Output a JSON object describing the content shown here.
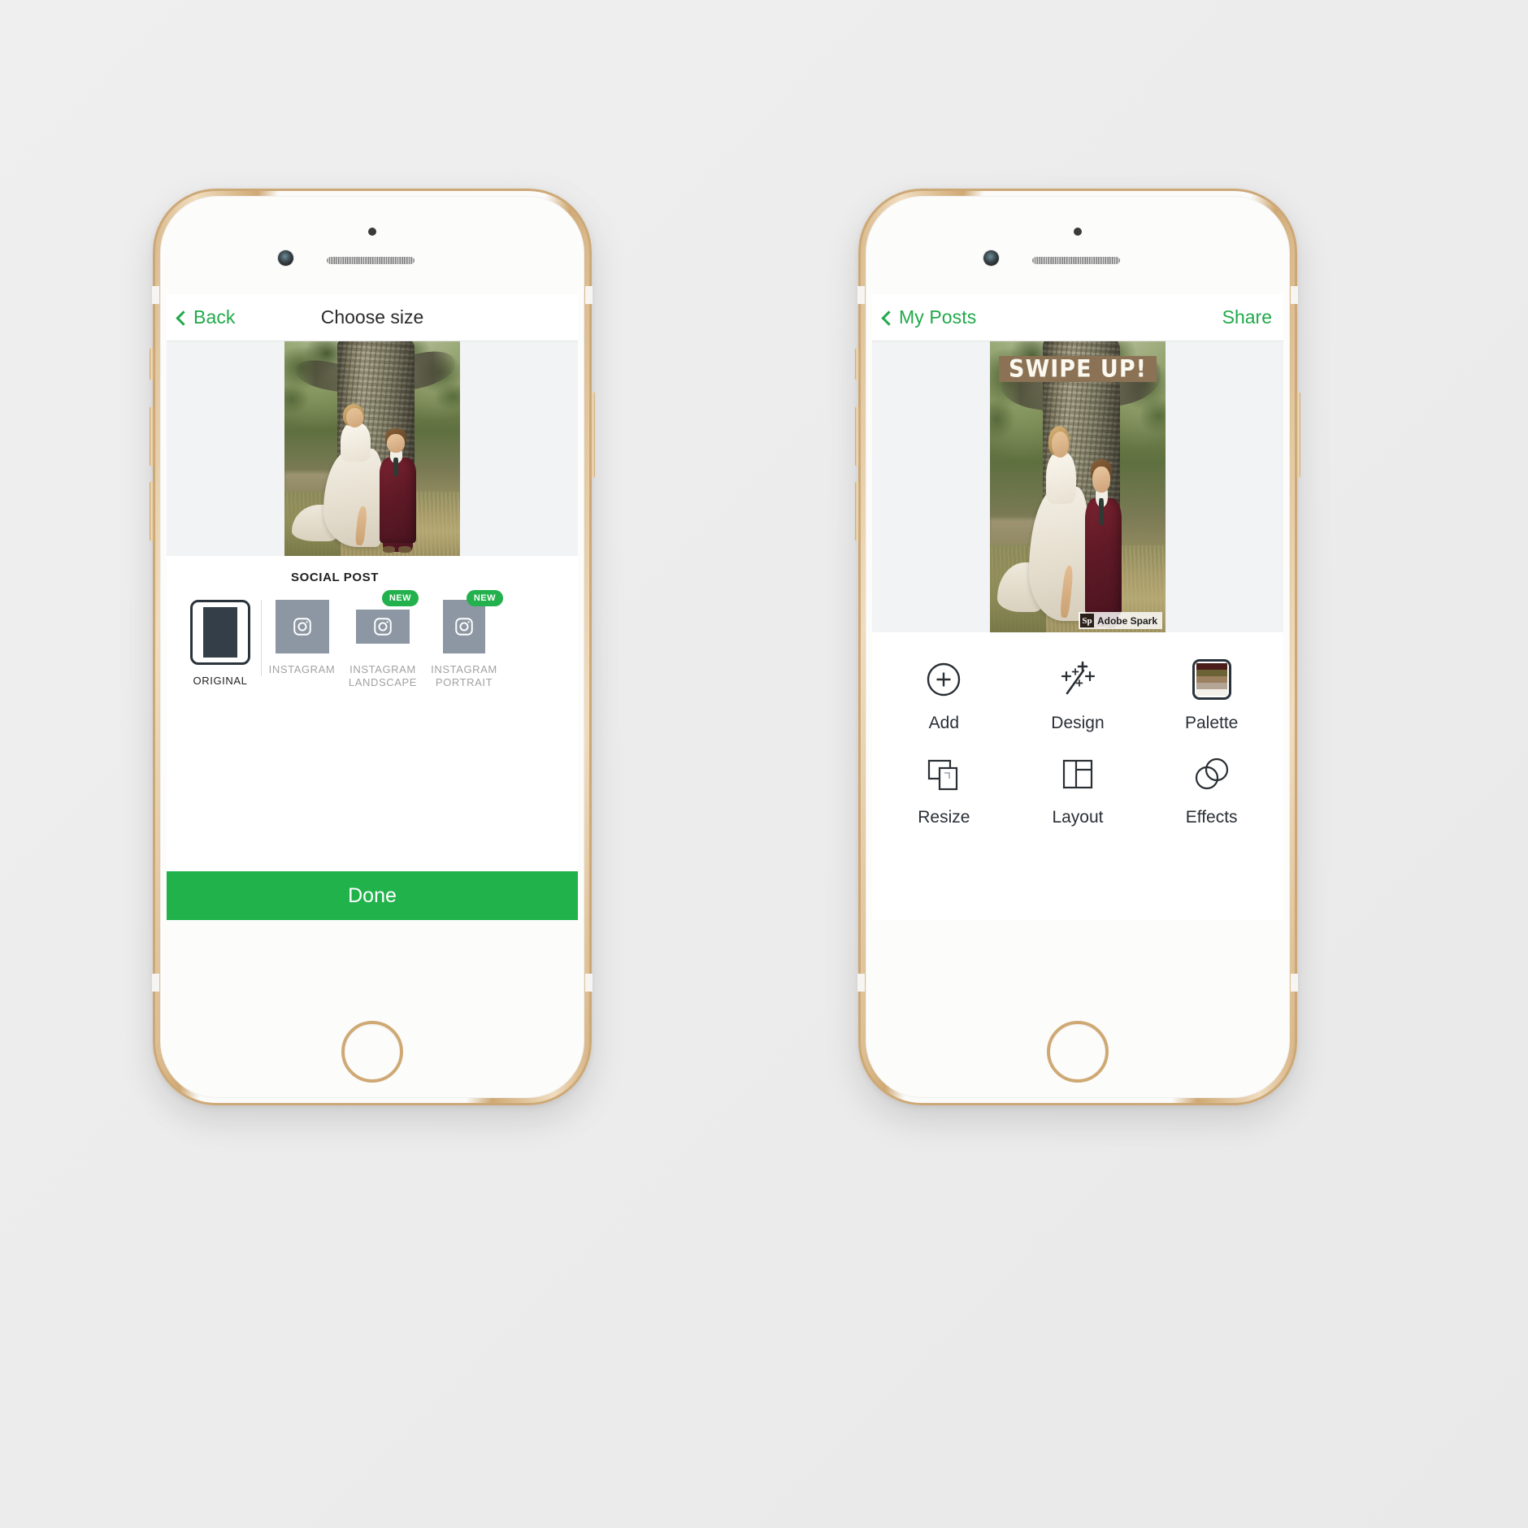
{
  "app": {
    "name": "Adobe Spark Post",
    "accent_green": "#21b24c",
    "text_dark": "#2a2f35"
  },
  "phone_left": {
    "navbar": {
      "back_label": "Back",
      "back_icon": "chevron-left-icon",
      "title": "Choose size"
    },
    "canvas": {
      "photo_alt": "wedding couple standing under large tree",
      "background": "#f2f3f4"
    },
    "sizes": {
      "section_label": "SOCIAL POST",
      "items": [
        {
          "caption": "ORIGINAL",
          "selected": true,
          "badge": null,
          "icon": "original-frame-icon",
          "shape": "portrait"
        },
        {
          "caption": "INSTAGRAM",
          "selected": false,
          "badge": null,
          "icon": "instagram-icon",
          "shape": "square"
        },
        {
          "caption": "INSTAGRAM LANDSCAPE",
          "caption_l1": "INSTAGRAM",
          "caption_l2": "LANDSCAPE",
          "selected": false,
          "badge": "NEW",
          "icon": "instagram-icon",
          "shape": "landscape"
        },
        {
          "caption": "INSTAGRAM PORTRAIT",
          "caption_l1": "INSTAGRAM",
          "caption_l2": "PORTRAIT",
          "selected": false,
          "badge": "NEW",
          "icon": "instagram-icon",
          "shape": "portrait"
        }
      ]
    },
    "done_label": "Done"
  },
  "phone_right": {
    "navbar": {
      "back_label": "My Posts",
      "back_icon": "chevron-left-icon",
      "share_label": "Share"
    },
    "canvas": {
      "banner_text": "SWIPE UP!",
      "banner_color": "#8b7255",
      "watermark_badge": "Sp",
      "watermark_label": "Adobe Spark",
      "photo_alt": "wedding couple standing under large tree"
    },
    "tools": [
      {
        "label": "Add",
        "icon": "plus-circle-icon"
      },
      {
        "label": "Design",
        "icon": "magic-wand-icon"
      },
      {
        "label": "Palette",
        "icon": "color-palette-icon"
      },
      {
        "label": "Resize",
        "icon": "resize-frames-icon"
      },
      {
        "label": "Layout",
        "icon": "layout-grid-icon"
      },
      {
        "label": "Effects",
        "icon": "overlapping-circles-icon"
      }
    ],
    "palette_swatches": [
      "#4a1d1a",
      "#6b6236",
      "#9b8160",
      "#b3a493",
      "#f3f0e9"
    ]
  }
}
